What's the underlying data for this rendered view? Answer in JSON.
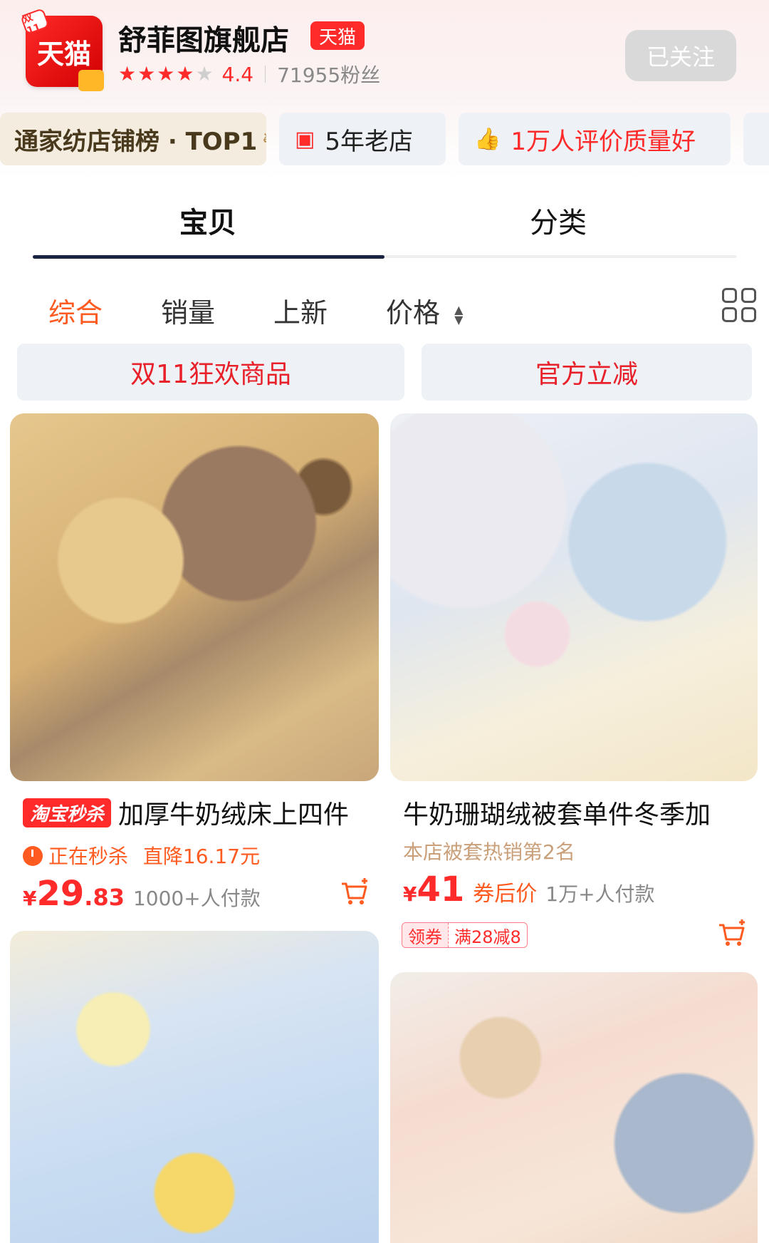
{
  "store": {
    "logo_text": "天猫",
    "logo_corner": "双11",
    "name": "舒菲图旗舰店",
    "badge": "天猫",
    "rating": "4.4",
    "fans": "71955粉丝",
    "follow_label": "已关注"
  },
  "tags": [
    {
      "text": "通家纺店铺榜 · TOP1"
    },
    {
      "text": "5年老店"
    },
    {
      "text_prefix": "1万人评价",
      "text_highlight": "质量好"
    }
  ],
  "main_tabs": [
    {
      "label": "宝贝",
      "active": true
    },
    {
      "label": "分类",
      "active": false
    }
  ],
  "sort": [
    {
      "label": "综合",
      "active": true
    },
    {
      "label": "销量"
    },
    {
      "label": "上新"
    },
    {
      "label": "价格"
    }
  ],
  "chips": [
    {
      "label": "双11狂欢商品"
    },
    {
      "label": "官方立减"
    }
  ],
  "products": [
    {
      "badge": "淘宝秒杀",
      "title": "加厚牛奶绒床上四件",
      "status": "正在秒杀",
      "discount": "直降16.17元",
      "currency": "¥",
      "price_int": "29",
      "price_dec": ".83",
      "sold": "1000+人付款"
    },
    {
      "title": "牛奶珊瑚绒被套单件冬季加",
      "rank": "本店被套热销第2名",
      "currency": "¥",
      "price_int": "41",
      "price_note": "券后价",
      "sold": "1万+人付款",
      "coupon_label": "领券",
      "coupon_value": "满28减8"
    }
  ],
  "colors": {
    "accent_red": "#ff2a2a",
    "accent_orange": "#ff5a1f",
    "tab_indicator": "#1a2340"
  }
}
